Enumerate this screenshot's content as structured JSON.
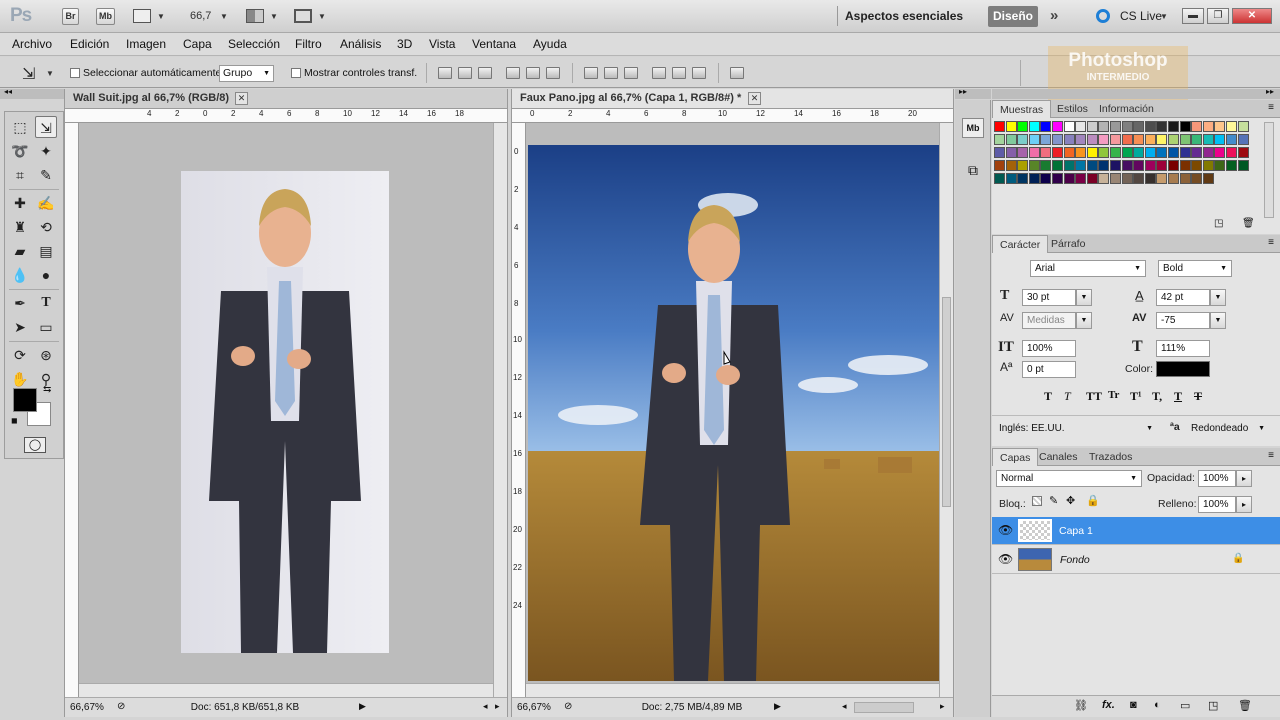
{
  "titlebar": {
    "logo": "Ps",
    "br": "Br",
    "mb": "Mb",
    "zoom": "66,7",
    "workspace_essentials": "Aspectos esenciales",
    "workspace_design": "Diseño",
    "more": "»",
    "cs_live": "CS Live"
  },
  "menu": [
    "Archivo",
    "Edición",
    "Imagen",
    "Capa",
    "Selección",
    "Filtro",
    "Análisis",
    "3D",
    "Vista",
    "Ventana",
    "Ayuda"
  ],
  "options": {
    "auto_select_label": "Seleccionar automáticamente:",
    "auto_select_value": "Grupo",
    "show_transform_label": "Mostrar controles transf."
  },
  "watermark": {
    "line1": "Photoshop",
    "line2": "INTERMEDIO"
  },
  "doc1": {
    "title": "Wall Suit.jpg al 66,7% (RGB/8)",
    "zoom": "66,67%",
    "doc_info": "Doc: 651,8 KB/651,8 KB",
    "ruler_labels": [
      "4",
      "2",
      "0",
      "2",
      "4",
      "6",
      "8",
      "10",
      "12",
      "14",
      "16",
      "18"
    ]
  },
  "doc2": {
    "title": "Faux Pano.jpg al 66,7% (Capa 1, RGB/8#) *",
    "zoom": "66,67%",
    "doc_info": "Doc: 2,75 MB/4,89 MB",
    "ruler_labels": [
      "0",
      "2",
      "4",
      "6",
      "8",
      "10",
      "12",
      "14",
      "16",
      "18",
      "20"
    ],
    "vruler_labels": [
      "0",
      "2",
      "4",
      "6",
      "8",
      "10",
      "12",
      "14",
      "16",
      "18",
      "20",
      "22",
      "24"
    ]
  },
  "swatches_panel": {
    "tabs": [
      "Muestras",
      "Estilos",
      "Información"
    ],
    "colors": [
      "#ff0000",
      "#ffff00",
      "#00ff00",
      "#00ffff",
      "#0000ff",
      "#ff00ff",
      "#ffffff",
      "#e6e6e6",
      "#cccccc",
      "#b3b3b3",
      "#999999",
      "#808080",
      "#666666",
      "#4d4d4d",
      "#333333",
      "#1a1a1a",
      "#000000",
      "#f7977a",
      "#fbad82",
      "#fdc68c",
      "#fff799",
      "#c6df9c",
      "#a4d49d",
      "#81ca9d",
      "#7bcdc9",
      "#6ccff7",
      "#7ca6d8",
      "#8293ca",
      "#8881be",
      "#a286bd",
      "#bc8cbf",
      "#f49bc1",
      "#f5999d",
      "#f16c4d",
      "#f68e54",
      "#fbaf5a",
      "#fff467",
      "#acd372",
      "#7dc473",
      "#39b778",
      "#16bcb4",
      "#00bff3",
      "#438ccb",
      "#5573b7",
      "#5e5ca7",
      "#855fa8",
      "#a763a9",
      "#ef6ea8",
      "#f16d7e",
      "#ee1d24",
      "#f16522",
      "#f7941d",
      "#fff100",
      "#8fc63d",
      "#37b44a",
      "#00a650",
      "#00a99e",
      "#00aeef",
      "#0072bc",
      "#0054a5",
      "#2f3192",
      "#652c91",
      "#91278f",
      "#ed008c",
      "#ee105a",
      "#9d0a0f",
      "#a1410d",
      "#a36209",
      "#aba000",
      "#588528",
      "#197b30",
      "#007236",
      "#00736a",
      "#0076a4",
      "#004a80",
      "#003370",
      "#1d1363",
      "#450e61",
      "#62055f",
      "#9e005c",
      "#9d0039",
      "#790000",
      "#7b3000",
      "#7c4900",
      "#827a00",
      "#3e6617",
      "#045f20",
      "#005824",
      "#005951",
      "#005b7e",
      "#003562",
      "#002056",
      "#0c004b",
      "#30004a",
      "#4b0048",
      "#7a0045",
      "#7a0026",
      "#c7b299",
      "#998675",
      "#736357",
      "#534741",
      "#37302d",
      "#c69c6d",
      "#a77c50",
      "#8c6239",
      "#754c24",
      "#603913"
    ]
  },
  "character_panel": {
    "tabs": [
      "Carácter",
      "Párrafo"
    ],
    "font_family": "Arial",
    "font_style": "Bold",
    "size": "30 pt",
    "leading": "42 pt",
    "kerning": "Medidas",
    "tracking": "-75",
    "vscale": "100%",
    "hscale": "111%",
    "baseline": "0 pt",
    "color_label": "Color:",
    "text_color": "#000000",
    "style_buttons": [
      "T",
      "T",
      "TT",
      "Tr",
      "T¹",
      "T,",
      "T",
      "T"
    ],
    "language": "Inglés: EE.UU.",
    "aa_icon": "ªa",
    "antialias": "Redondeado"
  },
  "layers_panel": {
    "tabs": [
      "Capas",
      "Canales",
      "Trazados"
    ],
    "blend_mode": "Normal",
    "opacity_label": "Opacidad:",
    "opacity": "100%",
    "lock_label": "Bloq.:",
    "fill_label": "Relleno:",
    "fill": "100%",
    "layers": [
      {
        "name": "Capa 1",
        "selected": true
      },
      {
        "name": "Fondo",
        "selected": false
      }
    ]
  }
}
